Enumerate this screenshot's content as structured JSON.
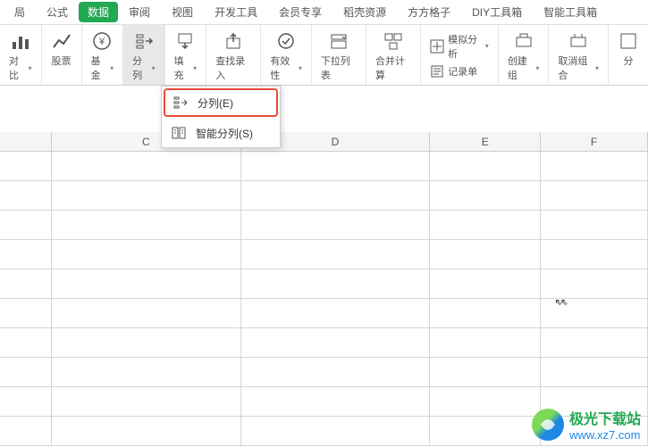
{
  "tabs": {
    "layout": "局",
    "formula": "公式",
    "data": "数据",
    "review": "审阅",
    "view": "视图",
    "dev": "开发工具",
    "member": "会员专享",
    "daoke": "稻壳资源",
    "fanggezi": "方方格子",
    "diy": "DIY工具箱",
    "smart": "智能工具箱"
  },
  "ribbon": {
    "compare": "对比",
    "stock": "股票",
    "fund": "基金",
    "split": "分列",
    "fill": "填充",
    "find": "查找录入",
    "validity": "有效性",
    "dropdown": "下拉列表",
    "merge": "合并计算",
    "simulate": "模拟分析",
    "record": "记录单",
    "group": "创建组",
    "ungroup": "取消组合",
    "sub": "分"
  },
  "menu": {
    "split": "分列(E)",
    "smart_split": "智能分列(S)"
  },
  "cols": {
    "c": "C",
    "d": "D",
    "e": "E",
    "f": "F"
  },
  "watermark": {
    "name": "极光下载站",
    "url": "www.xz7.com"
  }
}
